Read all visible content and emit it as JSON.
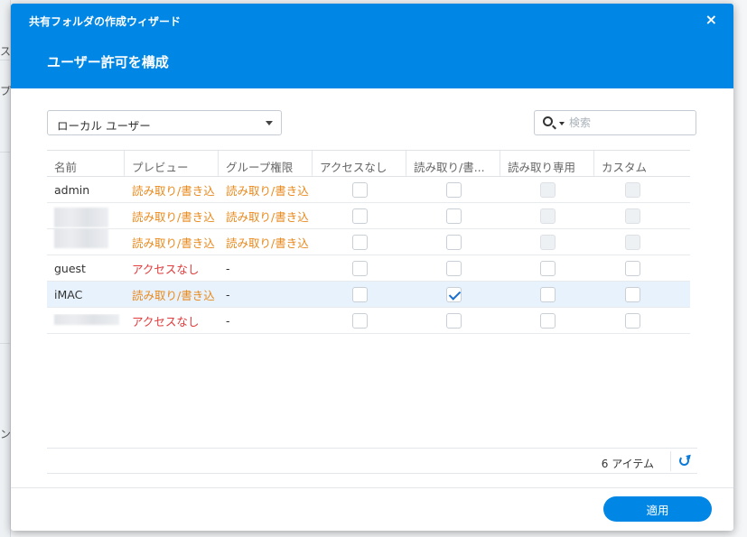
{
  "background": {
    "side_glyphs": [
      "ス",
      "プ",
      "ン"
    ]
  },
  "dialog": {
    "wizard_title": "共有フォルダの作成ウィザード",
    "step_title": "ユーザー許可を構成",
    "close_icon": "×",
    "user_type_dropdown": {
      "selected": "ローカル ユーザー"
    },
    "search": {
      "placeholder": "検索"
    },
    "table": {
      "columns": [
        "名前",
        "プレビュー",
        "グループ権限",
        "アクセスなし",
        "読み取り/書...",
        "読み取り専用",
        "カスタム"
      ],
      "rows": [
        {
          "name": "admin",
          "preview": "読み取り/書き込",
          "group": "読み取り/書き込"
        },
        {
          "name": "",
          "preview": "読み取り/書き込",
          "group": "読み取り/書き込"
        },
        {
          "name": "",
          "preview": "読み取り/書き込",
          "group": "読み取り/書き込"
        },
        {
          "name": "guest",
          "preview": "アクセスなし",
          "group": "-"
        },
        {
          "name": "iMAC",
          "preview": "読み取り/書き込",
          "group": "-"
        },
        {
          "name": "",
          "preview": "アクセスなし",
          "group": "-"
        }
      ]
    },
    "item_count": "6 アイテム",
    "apply_label": "適用"
  },
  "colors": {
    "accent": "#0086e5",
    "orange_text": "#e8891c",
    "red_text": "#e23b3b"
  }
}
